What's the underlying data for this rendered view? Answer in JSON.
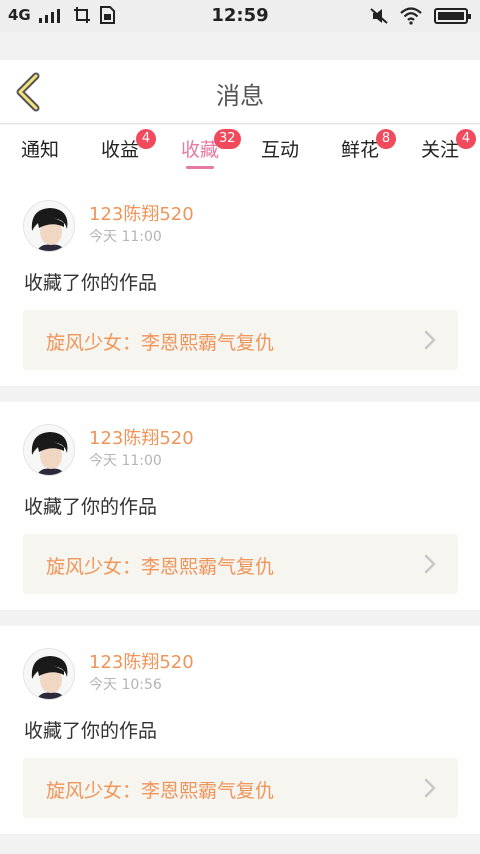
{
  "status_bar": {
    "network": "4G",
    "time": "12:59"
  },
  "header": {
    "title": "消息"
  },
  "tabs": [
    {
      "label": "通知",
      "badge": ""
    },
    {
      "label": "收益",
      "badge": "4"
    },
    {
      "label": "收藏",
      "badge": "32"
    },
    {
      "label": "互动",
      "badge": ""
    },
    {
      "label": "鲜花",
      "badge": "8"
    },
    {
      "label": "关注",
      "badge": "4"
    }
  ],
  "active_tab": "收藏",
  "colors": {
    "accent_pink": "#e57aa3",
    "name_orange": "#f0955a",
    "badge_red": "#f04a5c"
  },
  "feed": [
    {
      "username": "123陈翔520",
      "time": "今天 11:00",
      "message": "收藏了你的作品",
      "work_title": "旋风少女：李恩熙霸气复仇"
    },
    {
      "username": "123陈翔520",
      "time": "今天 11:00",
      "message": "收藏了你的作品",
      "work_title": "旋风少女：李恩熙霸气复仇"
    },
    {
      "username": "123陈翔520",
      "time": "今天 10:56",
      "message": "收藏了你的作品",
      "work_title": "旋风少女：李恩熙霸气复仇"
    }
  ]
}
